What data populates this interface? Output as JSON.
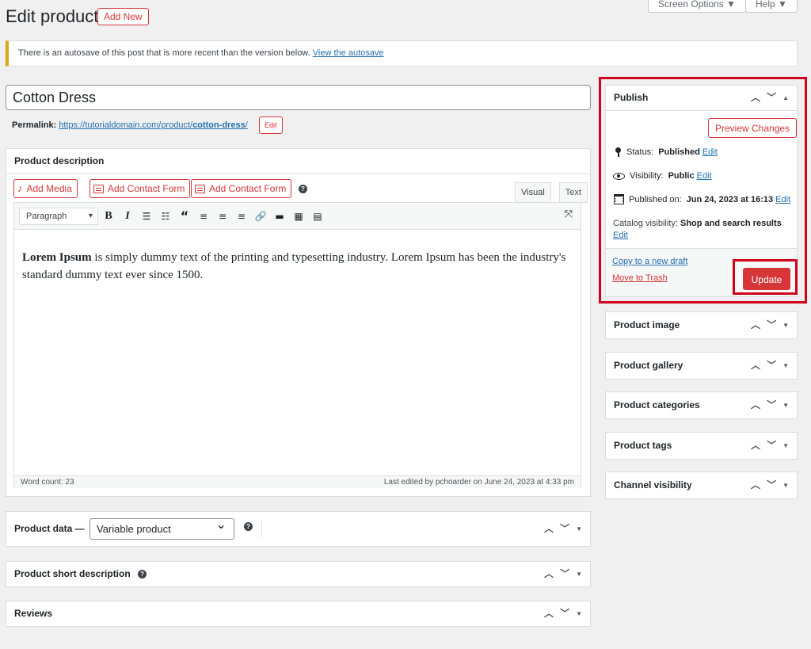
{
  "header": {
    "title": "Edit product",
    "add_new": "Add New",
    "screen_options": "Screen Options ▼",
    "help": "Help ▼"
  },
  "notice": {
    "text": "There is an autosave of this post that is more recent than the version below.",
    "link": "View the autosave"
  },
  "product": {
    "title": "Cotton Dress",
    "permalink_label": "Permalink:",
    "permalink_base": "https://tutorialdomain.com/product/",
    "permalink_slug": "cotton-dress",
    "permalink_end": "/",
    "permalink_edit": "Edit"
  },
  "description": {
    "heading": "Product description",
    "add_media": "Add Media",
    "add_contact_form_1": "Add Contact Form",
    "add_contact_form_2": "Add Contact Form",
    "tab_visual": "Visual",
    "tab_text": "Text",
    "format": "Paragraph",
    "content_bold": "Lorem Ipsum",
    "content_rest": " is simply dummy text of the printing and typesetting industry. Lorem Ipsum has been the industry's standard dummy text ever since 1500.",
    "word_count": "Word count: 23",
    "last_edited": "Last edited by pchoarder on June 24, 2023 at 4:33 pm"
  },
  "product_data": {
    "label": "Product data —",
    "type": "Variable product"
  },
  "short_description": {
    "heading": "Product short description"
  },
  "reviews": {
    "heading": "Reviews"
  },
  "publish": {
    "heading": "Publish",
    "preview": "Preview Changes",
    "status_label": "Status:",
    "status_value": "Published",
    "visibility_label": "Visibility:",
    "visibility_value": "Public",
    "published_label": "Published on:",
    "published_value": "Jun 24, 2023 at 16:13",
    "catalog_label": "Catalog visibility:",
    "catalog_value": "Shop and search results",
    "edit": "Edit",
    "copy_draft": "Copy to a new draft",
    "trash": "Move to Trash",
    "update": "Update"
  },
  "sidebar": {
    "product_image": "Product image",
    "product_gallery": "Product gallery",
    "product_categories": "Product categories",
    "product_tags": "Product tags",
    "channel_visibility": "Channel visibility"
  },
  "colors": {
    "accent_red": "#d63638",
    "link_blue": "#2271b1",
    "highlight": "#d0021b",
    "notice_yellow": "#dba617"
  }
}
